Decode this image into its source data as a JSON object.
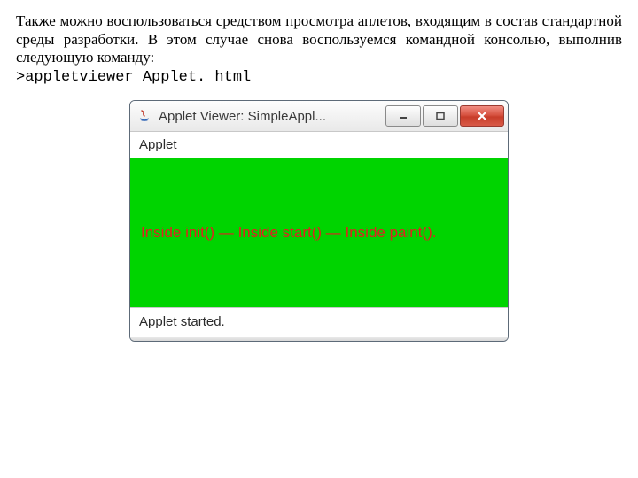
{
  "paragraph": "Также можно воспользоваться средством просмотра аплетов, входящим в состав стандартной среды разработки. В этом случае снова воспользуемся командной консолью, выполнив следующую команду:",
  "command": ">appletviewer Applet. html",
  "window": {
    "title": "Applet Viewer: SimpleAppl...",
    "menu": {
      "applet_label": "Applet"
    },
    "canvas_text": "Inside init() — Inside start() — Inside paint().",
    "status": "Applet started."
  }
}
